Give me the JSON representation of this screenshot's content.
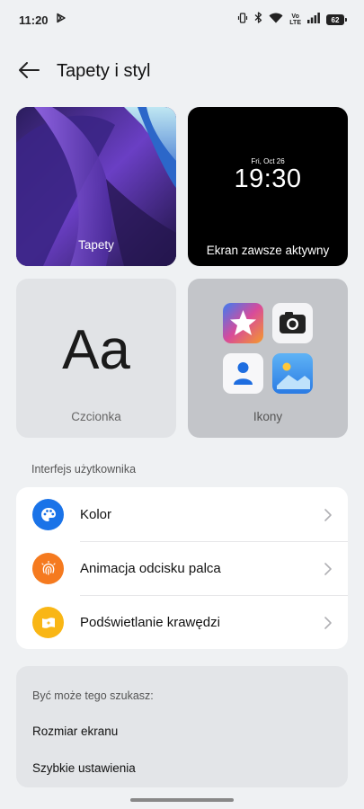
{
  "status_bar": {
    "time": "11:20",
    "volte_top": "Vo",
    "volte_bottom": "LTE",
    "battery": "62"
  },
  "header": {
    "title": "Tapety i styl"
  },
  "tiles": {
    "wallpaper": {
      "label": "Tapety"
    },
    "aod": {
      "label": "Ekran zawsze aktywny",
      "date": "Fri, Oct 26",
      "time": "19:30"
    },
    "font": {
      "label": "Czcionka",
      "sample": "Aa"
    },
    "icons": {
      "label": "Ikony"
    }
  },
  "section": {
    "title": "Interfejs użytkownika"
  },
  "settings": [
    {
      "label": "Kolor",
      "icon": "palette-icon",
      "color": "#1a73e8"
    },
    {
      "label": "Animacja odcisku palca",
      "icon": "fingerprint-icon",
      "color": "#f57a1f"
    },
    {
      "label": "Podświetlanie krawędzi",
      "icon": "edge-light-icon",
      "color": "#f9b615"
    }
  ],
  "suggestions": {
    "title": "Być może tego szukasz:",
    "items": [
      "Rozmiar ekranu",
      "Szybkie ustawienia"
    ]
  }
}
